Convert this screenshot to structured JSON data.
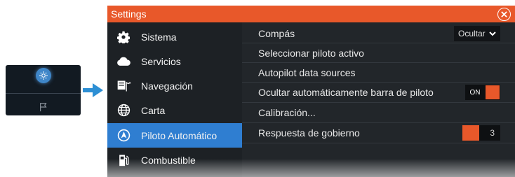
{
  "dialog": {
    "title": "Settings",
    "sidebar": [
      {
        "label": "Sistema",
        "icon": "gear-icon"
      },
      {
        "label": "Servicios",
        "icon": "cloud-icon"
      },
      {
        "label": "Navegación",
        "icon": "navigation-icon"
      },
      {
        "label": "Carta",
        "icon": "globe-icon"
      },
      {
        "label": "Piloto Automático",
        "icon": "autopilot-icon",
        "active": true
      },
      {
        "label": "Combustible",
        "icon": "fuel-pump-icon"
      }
    ],
    "settings": [
      {
        "label": "Compás",
        "control": "dropdown",
        "value": "Ocultar"
      },
      {
        "label": "Seleccionar piloto activo"
      },
      {
        "label": "Autopilot data sources"
      },
      {
        "label": "Ocultar automáticamente barra de piloto",
        "control": "toggle",
        "value": "ON"
      },
      {
        "label": "Calibración..."
      },
      {
        "label": "Respuesta de gobierno",
        "control": "slider",
        "value": "3",
        "level": 0.45
      }
    ]
  },
  "colors": {
    "accent": "#e8582a",
    "selection": "#2f7ed1",
    "panel": "#22262a",
    "sidebar": "#1d2125"
  }
}
